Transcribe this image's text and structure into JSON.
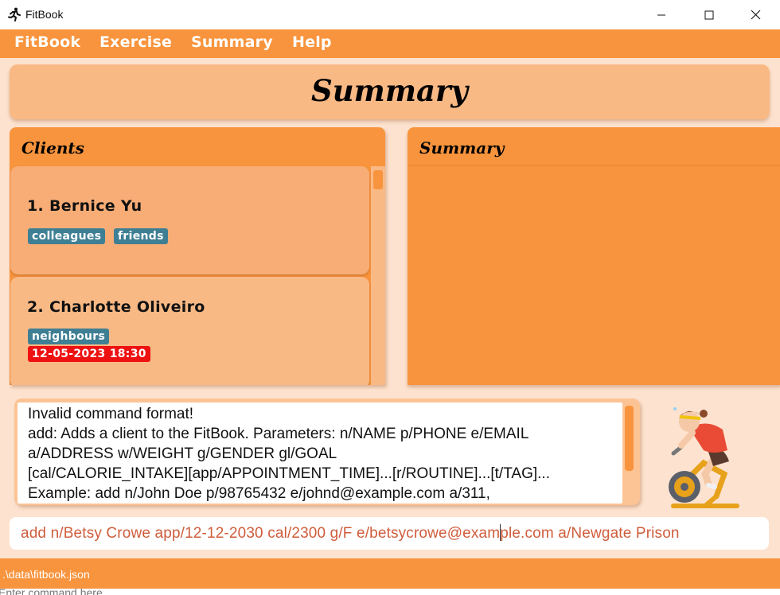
{
  "window": {
    "title": "FitBook",
    "app_icon": "running-person-icon",
    "controls": [
      "minimize-icon",
      "maximize-icon",
      "close-icon"
    ]
  },
  "menu": {
    "items": [
      {
        "label": "FitBook"
      },
      {
        "label": "Exercise"
      },
      {
        "label": "Summary"
      },
      {
        "label": "Help"
      }
    ]
  },
  "header": {
    "title": "Summary"
  },
  "clients_panel": {
    "title": "Clients",
    "clients": [
      {
        "name": "1.  Bernice Yu",
        "tags": [
          "colleagues",
          "friends"
        ],
        "appointments": []
      },
      {
        "name": "2.  Charlotte Oliveiro",
        "tags": [
          "neighbours"
        ],
        "appointments": [
          "12-05-2023 18:30"
        ]
      }
    ]
  },
  "summary_panel": {
    "title": "Summary"
  },
  "result": {
    "lines": [
      "Invalid command format!",
      "add: Adds a client to the FitBook. Parameters: n/NAME p/PHONE e/EMAIL",
      "a/ADDRESS w/WEIGHT g/GENDER gl/GOAL",
      "[cal/CALORIE_INTAKE][app/APPOINTMENT_TIME]...[r/ROUTINE]...[t/TAG]...",
      "Example: add n/John Doe p/98765432 e/johnd@example.com a/311,"
    ]
  },
  "command": {
    "value_before_caret": "add n/Betsy Crowe app/12-12-2030 cal/2300 g/F e/betsycrowe@exam",
    "value_after_caret": "ple.com a/Newgate Prison",
    "placeholder": "Enter command here..."
  },
  "status": {
    "file_path": ".\\data\\fitbook.json"
  },
  "colors": {
    "accent_orange": "#f8943d",
    "panel_peach": "#f9b985",
    "tag_teal": "#3f7f94",
    "appointment_red": "#ee1111",
    "command_text": "#cf5d3c"
  },
  "mascot": "exercise-bike-mascot"
}
